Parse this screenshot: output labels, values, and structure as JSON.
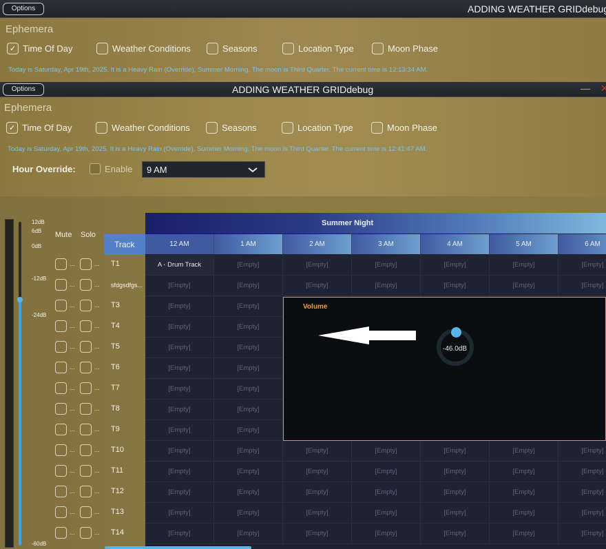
{
  "back_window": {
    "options_label": "Options",
    "title": "ADDING WEATHER GRIDdebug",
    "ephemera_label": "Ephemera",
    "filters": [
      {
        "label": "Time Of Day",
        "checked": true
      },
      {
        "label": "Weather Conditions",
        "checked": false
      },
      {
        "label": "Seasons",
        "checked": false
      },
      {
        "label": "Location Type",
        "checked": false
      },
      {
        "label": "Moon Phase",
        "checked": false
      }
    ],
    "status": "Today is Saturday, Apr 19th, 2025. It is a Heavy Rain (Override), Summer Morning. The moon is Third Quarter. The current time is 12:13:34 AM."
  },
  "front_window": {
    "options_label": "Options",
    "title": "ADDING WEATHER GRIDdebug",
    "minimize_glyph": "—",
    "close_glyph": "✕",
    "ephemera_label": "Ephemera",
    "filters": [
      {
        "label": "Time Of Day",
        "checked": true
      },
      {
        "label": "Weather Conditions",
        "checked": false
      },
      {
        "label": "Seasons",
        "checked": false
      },
      {
        "label": "Location Type",
        "checked": false
      },
      {
        "label": "Moon Phase",
        "checked": false
      }
    ],
    "status": "Today is Saturday, Apr 19th, 2025. It is a Heavy Rain (Override), Summer Morning. The moon is Third Quarter. The current time is 12:41:47 AM.",
    "hour_override": {
      "label": "Hour Override:",
      "enable_label": "Enable",
      "enabled": false,
      "selected": "9 AM"
    }
  },
  "meter": {
    "db_labels": [
      "12dB",
      "6dB",
      "0dB",
      "-12dB",
      "-24dB",
      "-60dB"
    ]
  },
  "mixer": {
    "mute_label": "Mute",
    "solo_label": "Solo",
    "dots": "...",
    "tracks": [
      "T1",
      "sfdgsdfgs...",
      "T3",
      "T4",
      "T5",
      "T6",
      "T7",
      "T8",
      "T9",
      "T10",
      "T11",
      "T12",
      "T13",
      "T14"
    ]
  },
  "grid": {
    "banner": "Summer Night",
    "track_header": "Track",
    "hours": [
      "12 AM",
      "1 AM",
      "2 AM",
      "3 AM",
      "4 AM",
      "5 AM",
      "6 AM"
    ],
    "empty_label": "[Empty]",
    "first_cell": "A - Drum Track"
  },
  "volume_popup": {
    "title": "Volume",
    "value": "-46.0dB"
  },
  "colors": {
    "accent_blue": "#5ab4e6",
    "popup_border": "#d4a13a",
    "status_text": "#7ec3ea"
  }
}
